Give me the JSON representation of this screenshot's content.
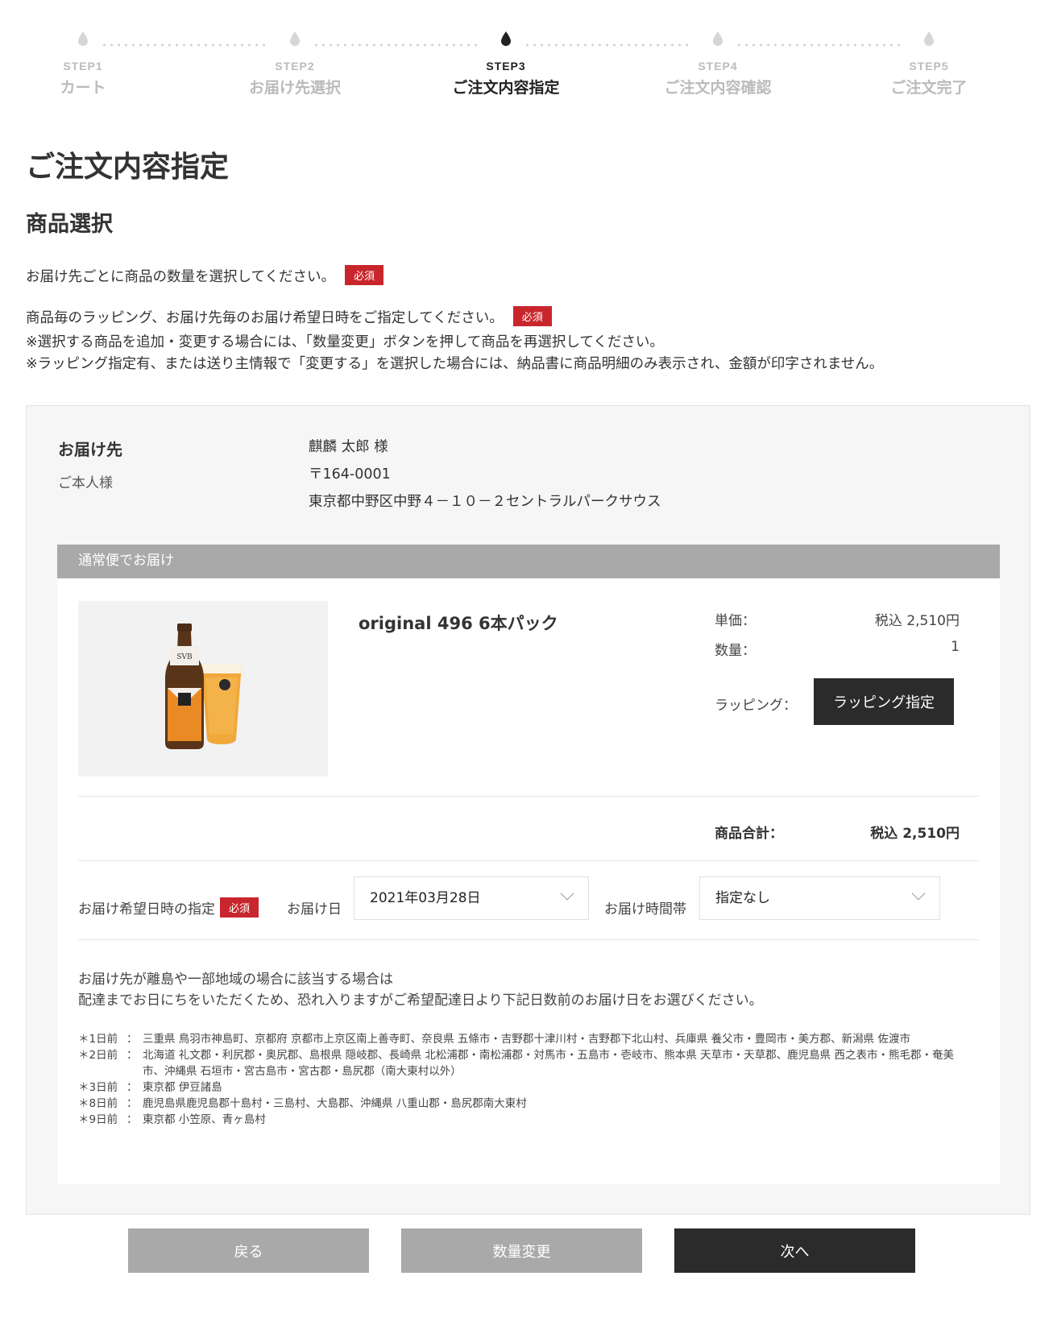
{
  "steps": [
    {
      "num": "STEP1",
      "name": "カート"
    },
    {
      "num": "STEP2",
      "name": "お届け先選択"
    },
    {
      "num": "STEP3",
      "name": "ご注文内容指定"
    },
    {
      "num": "STEP4",
      "name": "ご注文内容確認"
    },
    {
      "num": "STEP5",
      "name": "ご注文完了"
    }
  ],
  "active_step": 3,
  "page_title": "ご注文内容指定",
  "section_title": "商品選択",
  "required_label": "必須",
  "lead": {
    "line1": "お届け先ごとに商品の数量を選択してください。",
    "line2": "商品毎のラッピング、お届け先毎のお届け希望日時をご指定してください。",
    "line3": "※選択する商品を追加・変更する場合には、「数量変更」ボタンを押して商品を再選択してください。",
    "line4": "※ラッピング指定有、または送り主情報で「変更する」を選択した場合には、納品書に商品明細のみ表示され、金額が印字されません。"
  },
  "destination": {
    "title": "お届け先",
    "relation": "ご本人様",
    "name": "麒麟 太郎 様",
    "postal": "〒164-0001",
    "address": "東京都中野区中野４－１０－２セントラルパークサウス"
  },
  "shipping": {
    "method": "通常便でお届け",
    "product": {
      "name": "original 496 6本パック",
      "unit_price_label": "単価：",
      "unit_price": "税込 2,510円",
      "qty_label": "数量：",
      "qty": "1",
      "wrapping_label": "ラッピング：",
      "wrapping_button": "ラッピング指定",
      "bottle_label": "SVB"
    },
    "subtotal_label": "商品合計：",
    "subtotal": "税込 2,510円",
    "date_spec_label": "お届け希望日時の指定",
    "date_label": "お届け日",
    "date_value": "2021年03月28日",
    "time_label": "お届け時間帯",
    "time_value": "指定なし",
    "note_line1": "お届け先が離島や一部地域の場合に該当する場合は",
    "note_line2": "配達までお日にちをいただくため、恐れ入りますがご希望配達日より下記日数前のお届け日をお選びください。",
    "areas": [
      {
        "days": "＊1日前",
        "sep": "：",
        "text": "三重県 鳥羽市神島町、京都府 京都市上京区南上善寺町、奈良県 五條市・吉野郡十津川村・吉野郡下北山村、兵庫県 養父市・豊岡市・美方郡、新潟県 佐渡市"
      },
      {
        "days": "＊2日前",
        "sep": "：",
        "text": "北海道 礼文郡・利尻郡・奥尻郡、島根県 隠岐郡、長崎県 北松浦郡・南松浦郡・対馬市・五島市・壱岐市、熊本県 天草市・天草郡、鹿児島県 西之表市・熊毛郡・奄美市、沖縄県 石垣市・宮古島市・宮古郡・島尻郡（南大東村以外）"
      },
      {
        "days": "＊3日前",
        "sep": "：",
        "text": "東京都 伊豆諸島"
      },
      {
        "days": "＊8日前",
        "sep": "：",
        "text": "鹿児島県鹿児島郡十島村・三島村、大島郡、沖縄県 八重山郡・島尻郡南大東村"
      },
      {
        "days": "＊9日前",
        "sep": "：",
        "text": "東京都 小笠原、青ヶ島村"
      }
    ]
  },
  "buttons": {
    "back": "戻る",
    "change_qty": "数量変更",
    "next": "次へ"
  },
  "colors": {
    "required_badge": "#c8262c",
    "dark_button": "#2b2b2b",
    "gray_button": "#a9a9a9"
  }
}
